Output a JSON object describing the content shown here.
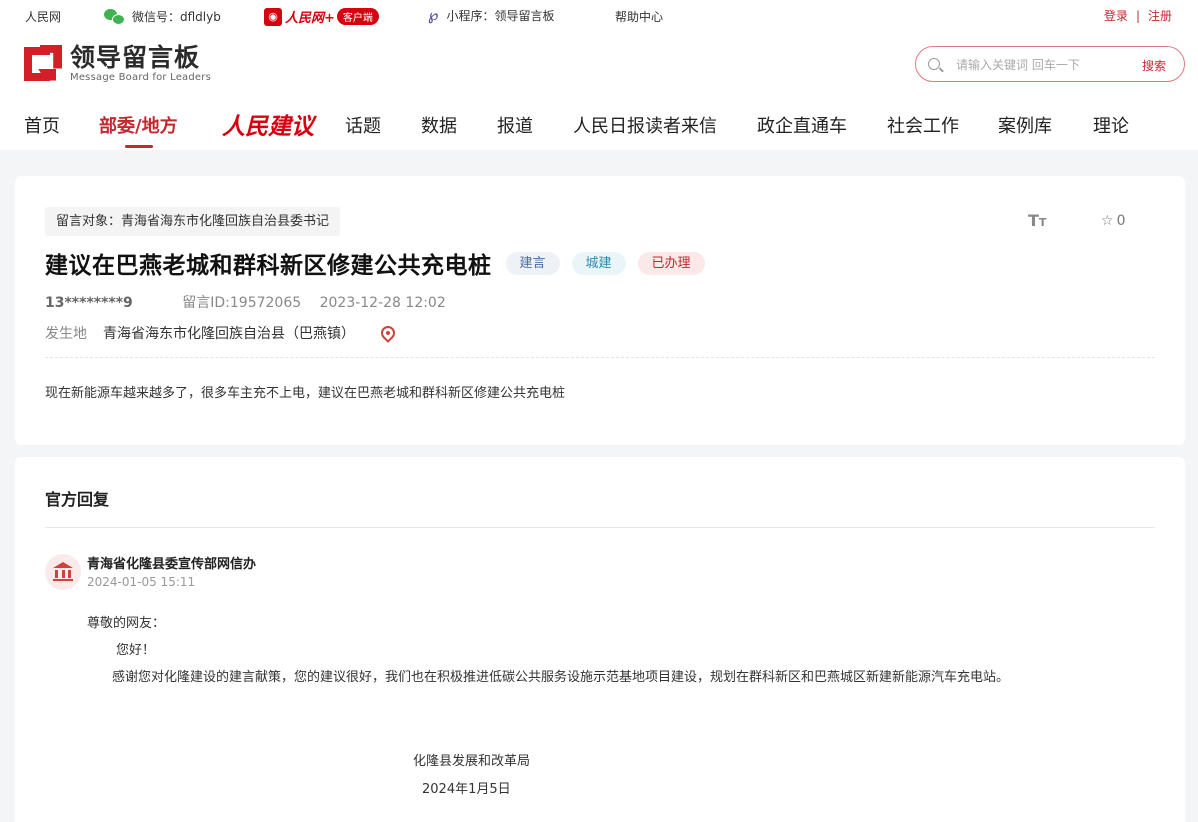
{
  "topbar": {
    "site": "人民网",
    "wechat_label": "微信号：dfldlyb",
    "rmw_logo_text": "人民网+",
    "rmw_badge": "客户端",
    "miniprogram_label": "小程序：领导留言板",
    "help": "帮助中心",
    "login": "登录",
    "separator": "|",
    "register": "注册"
  },
  "header": {
    "logo_cn": "领导留言板",
    "logo_en": "Message Board for Leaders",
    "search_placeholder": "请输入关键词 回车一下",
    "search_button": "搜索"
  },
  "nav": {
    "items": [
      "首页",
      "部委/地方",
      "人民建议",
      "话题",
      "数据",
      "报道",
      "人民日报读者来信",
      "政企直通车",
      "社会工作",
      "案例库",
      "理论"
    ],
    "active_index": 1
  },
  "message": {
    "target": "留言对象：青海省海东市化隆回族自治县委书记",
    "font_icon_label": "T",
    "font_icon_small": "T",
    "favorite_icon": "☆",
    "favorite_count": "0",
    "title": "建议在巴燕老城和群科新区修建公共充电桩",
    "tags": [
      "建言",
      "城建",
      "已办理"
    ],
    "user": "13********9",
    "message_id": "留言ID:19572065",
    "time": "2023-12-28 12:02",
    "location_label": "发生地",
    "location": "青海省海东市化隆回族自治县（巴燕镇）",
    "content": "现在新能源车越来越多了，很多车主充不上电，建议在巴燕老城和群科新区修建公共充电桩"
  },
  "reply": {
    "heading": "官方回复",
    "org": "青海省化隆县委宣传部网信办",
    "time": "2024-01-05 15:11",
    "greeting": "尊敬的网友：",
    "hello": "您好！",
    "body": "感谢您对化隆建设的建言献策，您的建议很好，我们也在积极推进低碳公共服务设施示范基地项目建设，规划在群科新区和巴燕城区新建新能源汽车充电站。",
    "signature": "化隆县发展和改革局",
    "date": "2024年1月5日"
  },
  "colors": {
    "brand_red": "#c2282e",
    "rmw_red": "#d7000f",
    "wechat_green": "#3fb34f",
    "page_bg": "#f4f5f7"
  }
}
